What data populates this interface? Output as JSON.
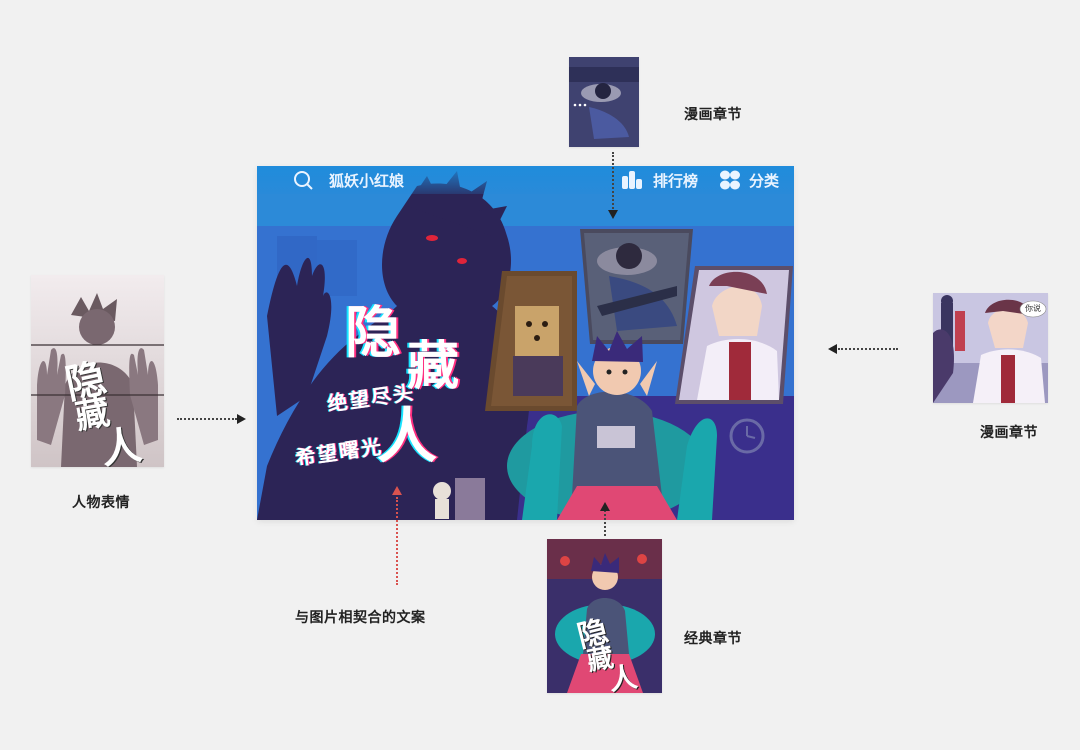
{
  "banner": {
    "search_placeholder": "狐妖小红娘",
    "ranking_label": "排行榜",
    "category_label": "分类",
    "title_chars": [
      "隐",
      "藏",
      "人"
    ],
    "subtitle_line1": "绝望尽头",
    "subtitle_line2": "希望曙光"
  },
  "annotations": {
    "top_right_label": "漫画章节",
    "right_label": "漫画章节",
    "left_label": "人物表情",
    "bottom_left_label": "与图片相契合的文案",
    "bottom_right_label": "经典章节"
  },
  "thumbnails": {
    "left_title_chars": [
      "隐",
      "藏",
      "人"
    ],
    "bottom_title_chars": [
      "隐",
      "藏",
      "人"
    ],
    "right_speech": "你说"
  },
  "colors": {
    "background": "#f1f1f1",
    "banner_blue": "#2d8fd8",
    "accent_pink": "#ff2f80",
    "accent_cyan": "#18e4ff",
    "arrow_red": "#d9534f"
  }
}
